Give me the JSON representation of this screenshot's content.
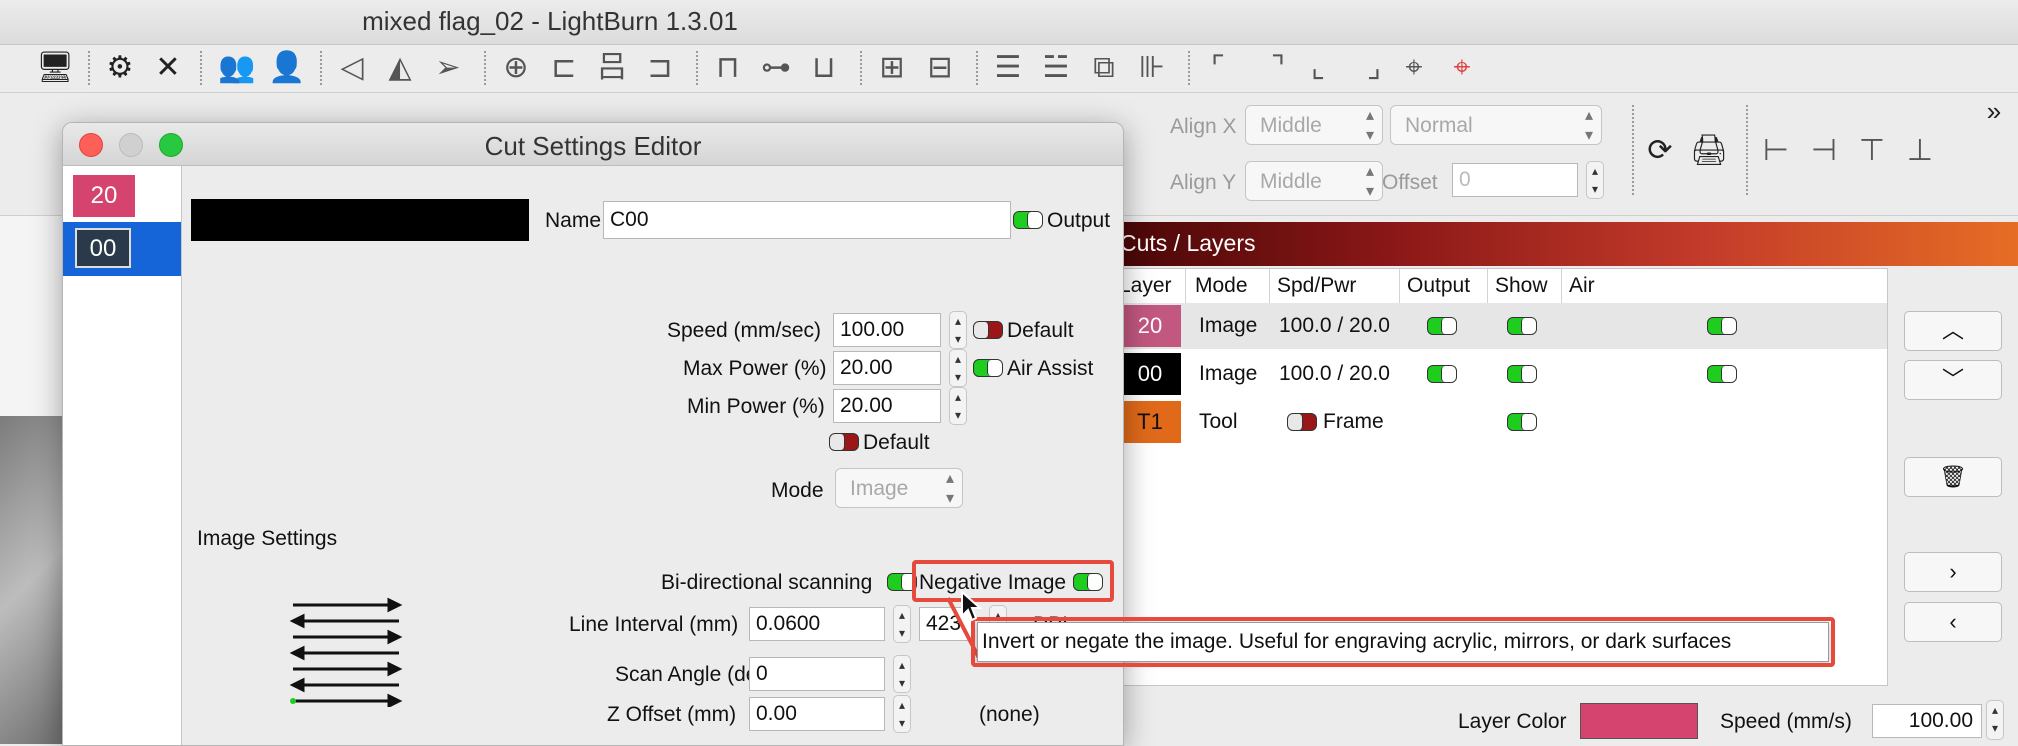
{
  "main_window": {
    "title": "mixed flag_02 - LightBurn 1.3.01"
  },
  "toolbar": {
    "icons": [
      "monitor-icon",
      "settings-gear-icon",
      "tools-icon",
      "users-icon",
      "user-icon",
      "flip-horizontal-icon",
      "mirror-icon",
      "send-icon",
      "target-icon",
      "align-left-icon",
      "align-center-icon",
      "align-right-icon",
      "align-top-icon",
      "align-middle-icon",
      "align-bottom-icon",
      "distribute-h-icon",
      "distribute-v-icon",
      "group-icon",
      "ungroup-icon",
      "space-h-icon",
      "space-v-icon",
      "corner-tl-icon",
      "corner-tr-icon",
      "corner-bl-icon",
      "corner-br-icon",
      "center-icon",
      "red-center-icon"
    ]
  },
  "props": {
    "align_x_label": "Align X",
    "align_x_value": "Middle",
    "align_y_label": "Align Y",
    "align_y_value": "Middle",
    "style_value": "Normal",
    "offset_label": "Offset",
    "offset_value": "0"
  },
  "dialog": {
    "title": "Cut Settings Editor",
    "layers": [
      {
        "label": "20",
        "color": "#d5446e"
      },
      {
        "label": "00",
        "color": "#000000"
      }
    ],
    "name_label": "Name",
    "name_value": "C00",
    "output_label": "Output",
    "speed_label": "Speed (mm/sec)",
    "speed_value": "100.00",
    "speed_default_label": "Default",
    "max_power_label": "Max Power (%)",
    "max_power_value": "20.00",
    "air_assist_label": "Air Assist",
    "min_power_label": "Min Power (%)",
    "min_power_value": "20.00",
    "power_default_label": "Default",
    "mode_label": "Mode",
    "mode_value": "Image",
    "image_settings_label": "Image Settings",
    "bidir_label": "Bi-directional scanning",
    "negative_label": "Negative Image",
    "line_interval_label": "Line Interval (mm)",
    "line_interval_value": "0.0600",
    "dpi_value": "423",
    "dpi_label": "DPI",
    "scan_angle_label": "Scan Angle (deg)",
    "scan_angle_value": "0",
    "z_offset_label": "Z Offset (mm)",
    "z_offset_value": "0.00",
    "none_label": "(none)"
  },
  "tooltip": {
    "text": "Invert or negate the image. Useful for engraving acrylic, mirrors, or dark surfaces"
  },
  "cuts_panel": {
    "title": "Cuts / Layers",
    "columns": [
      "Layer",
      "Mode",
      "Spd/Pwr",
      "Output",
      "Show",
      "Air"
    ],
    "rows": [
      {
        "layer": "20",
        "color": "#c2577f",
        "mode": "Image",
        "spd_pwr": "100.0 / 20.0",
        "output": true,
        "show": true,
        "air": true
      },
      {
        "layer": "00",
        "color": "#000000",
        "mode": "Image",
        "spd_pwr": "100.0 / 20.0",
        "output": true,
        "show": true,
        "air": true
      },
      {
        "layer": "T1",
        "color": "#e06a1a",
        "mode": "Tool",
        "spd_pwr": "Frame",
        "output": false,
        "show": true,
        "air": false
      }
    ],
    "layer_color_label": "Layer Color",
    "layer_color": "#d5446e",
    "speed_label": "Speed (mm/s)",
    "speed_value": "100.00"
  }
}
